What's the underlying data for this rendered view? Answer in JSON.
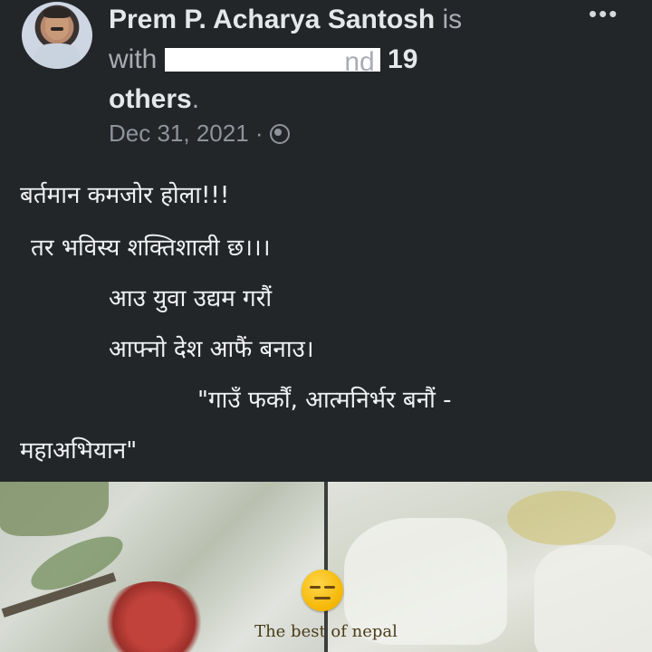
{
  "post": {
    "author": "Prem P. Acharya Santosh",
    "is_text": "is",
    "with_text": "with",
    "tagged_suffix": "nd",
    "others_count": "19",
    "others_text": "others",
    "period": ".",
    "date": "Dec 31, 2021",
    "separator": "·",
    "privacy_icon": "globe-icon",
    "more_icon": "more-options-icon",
    "more_label": "•••",
    "lines": [
      "बर्तमान कमजोर होला!!!",
      "तर भविस्य शक्तिशाली छ।।।",
      "आउ युवा उद्यम गरौं",
      "आफ्नो देश आफैं बनाउ।",
      "\"गाउँ फर्कौं, आत्मनिर्भर बनौं -",
      "महाअभियान\""
    ]
  },
  "image": {
    "emoji": "expressionless-face-icon",
    "caption": "The best of nepal"
  }
}
